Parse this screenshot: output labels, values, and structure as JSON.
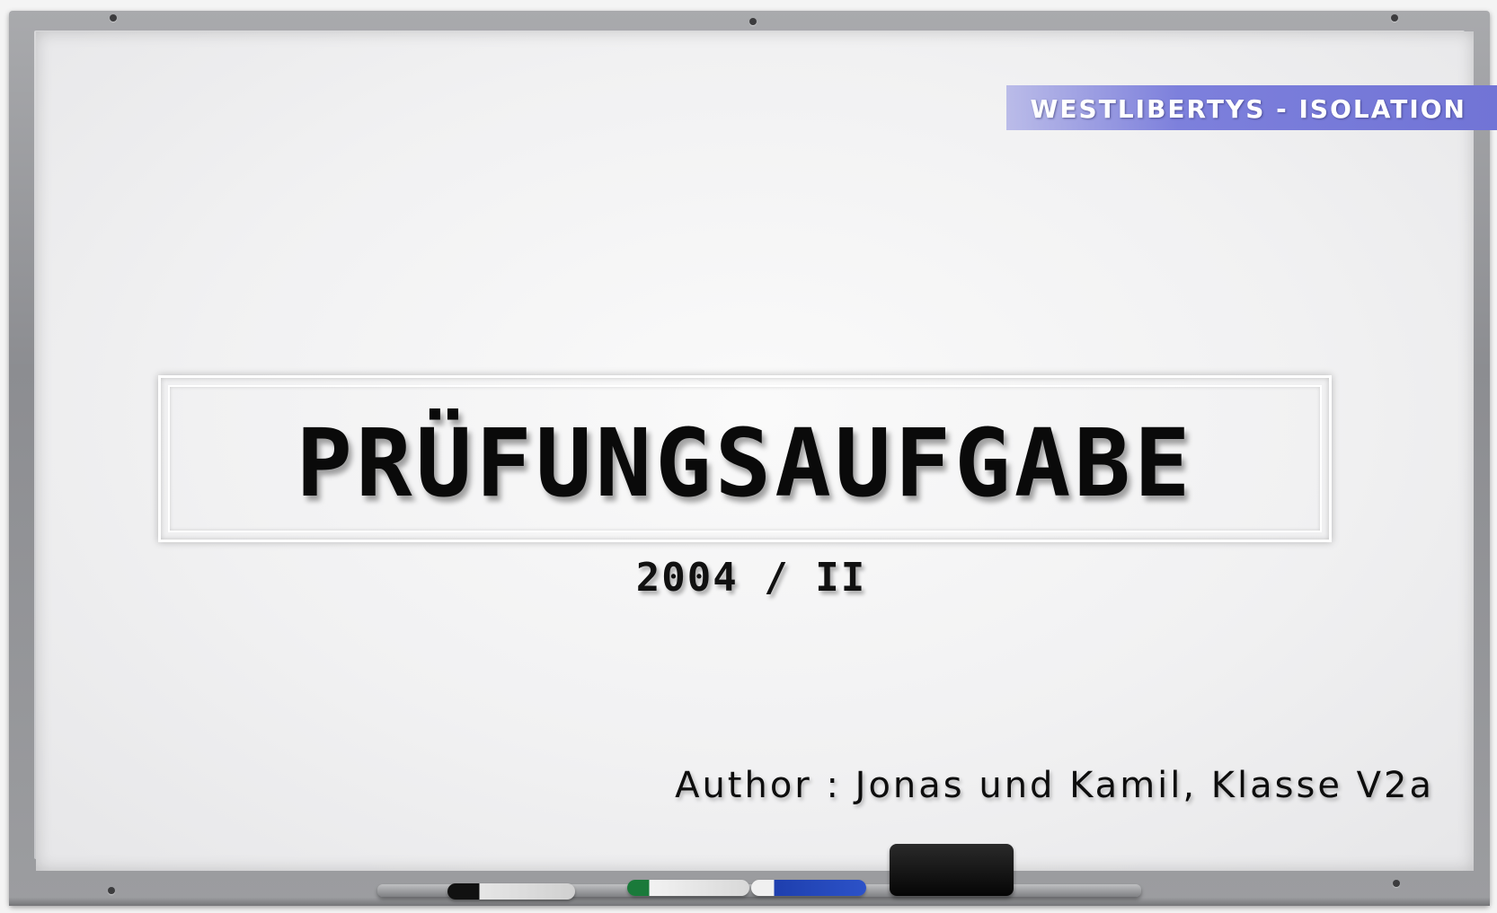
{
  "tag": {
    "text": "WESTLIBERTYS - ISOLATION"
  },
  "title": {
    "text": "PRÜFUNGSAUFGABE"
  },
  "subtitle": {
    "text": "2004 / II"
  },
  "author": {
    "text": "Author : Jonas und Kamil, Klasse V2a"
  },
  "colors": {
    "tag_background": "#7174d6",
    "board": "#f4f4f4",
    "frame": "#9c9da0",
    "text": "#0a0a0a"
  },
  "icons": [
    "black-marker-icon",
    "green-marker-icon",
    "blue-marker-icon",
    "eraser-icon"
  ]
}
